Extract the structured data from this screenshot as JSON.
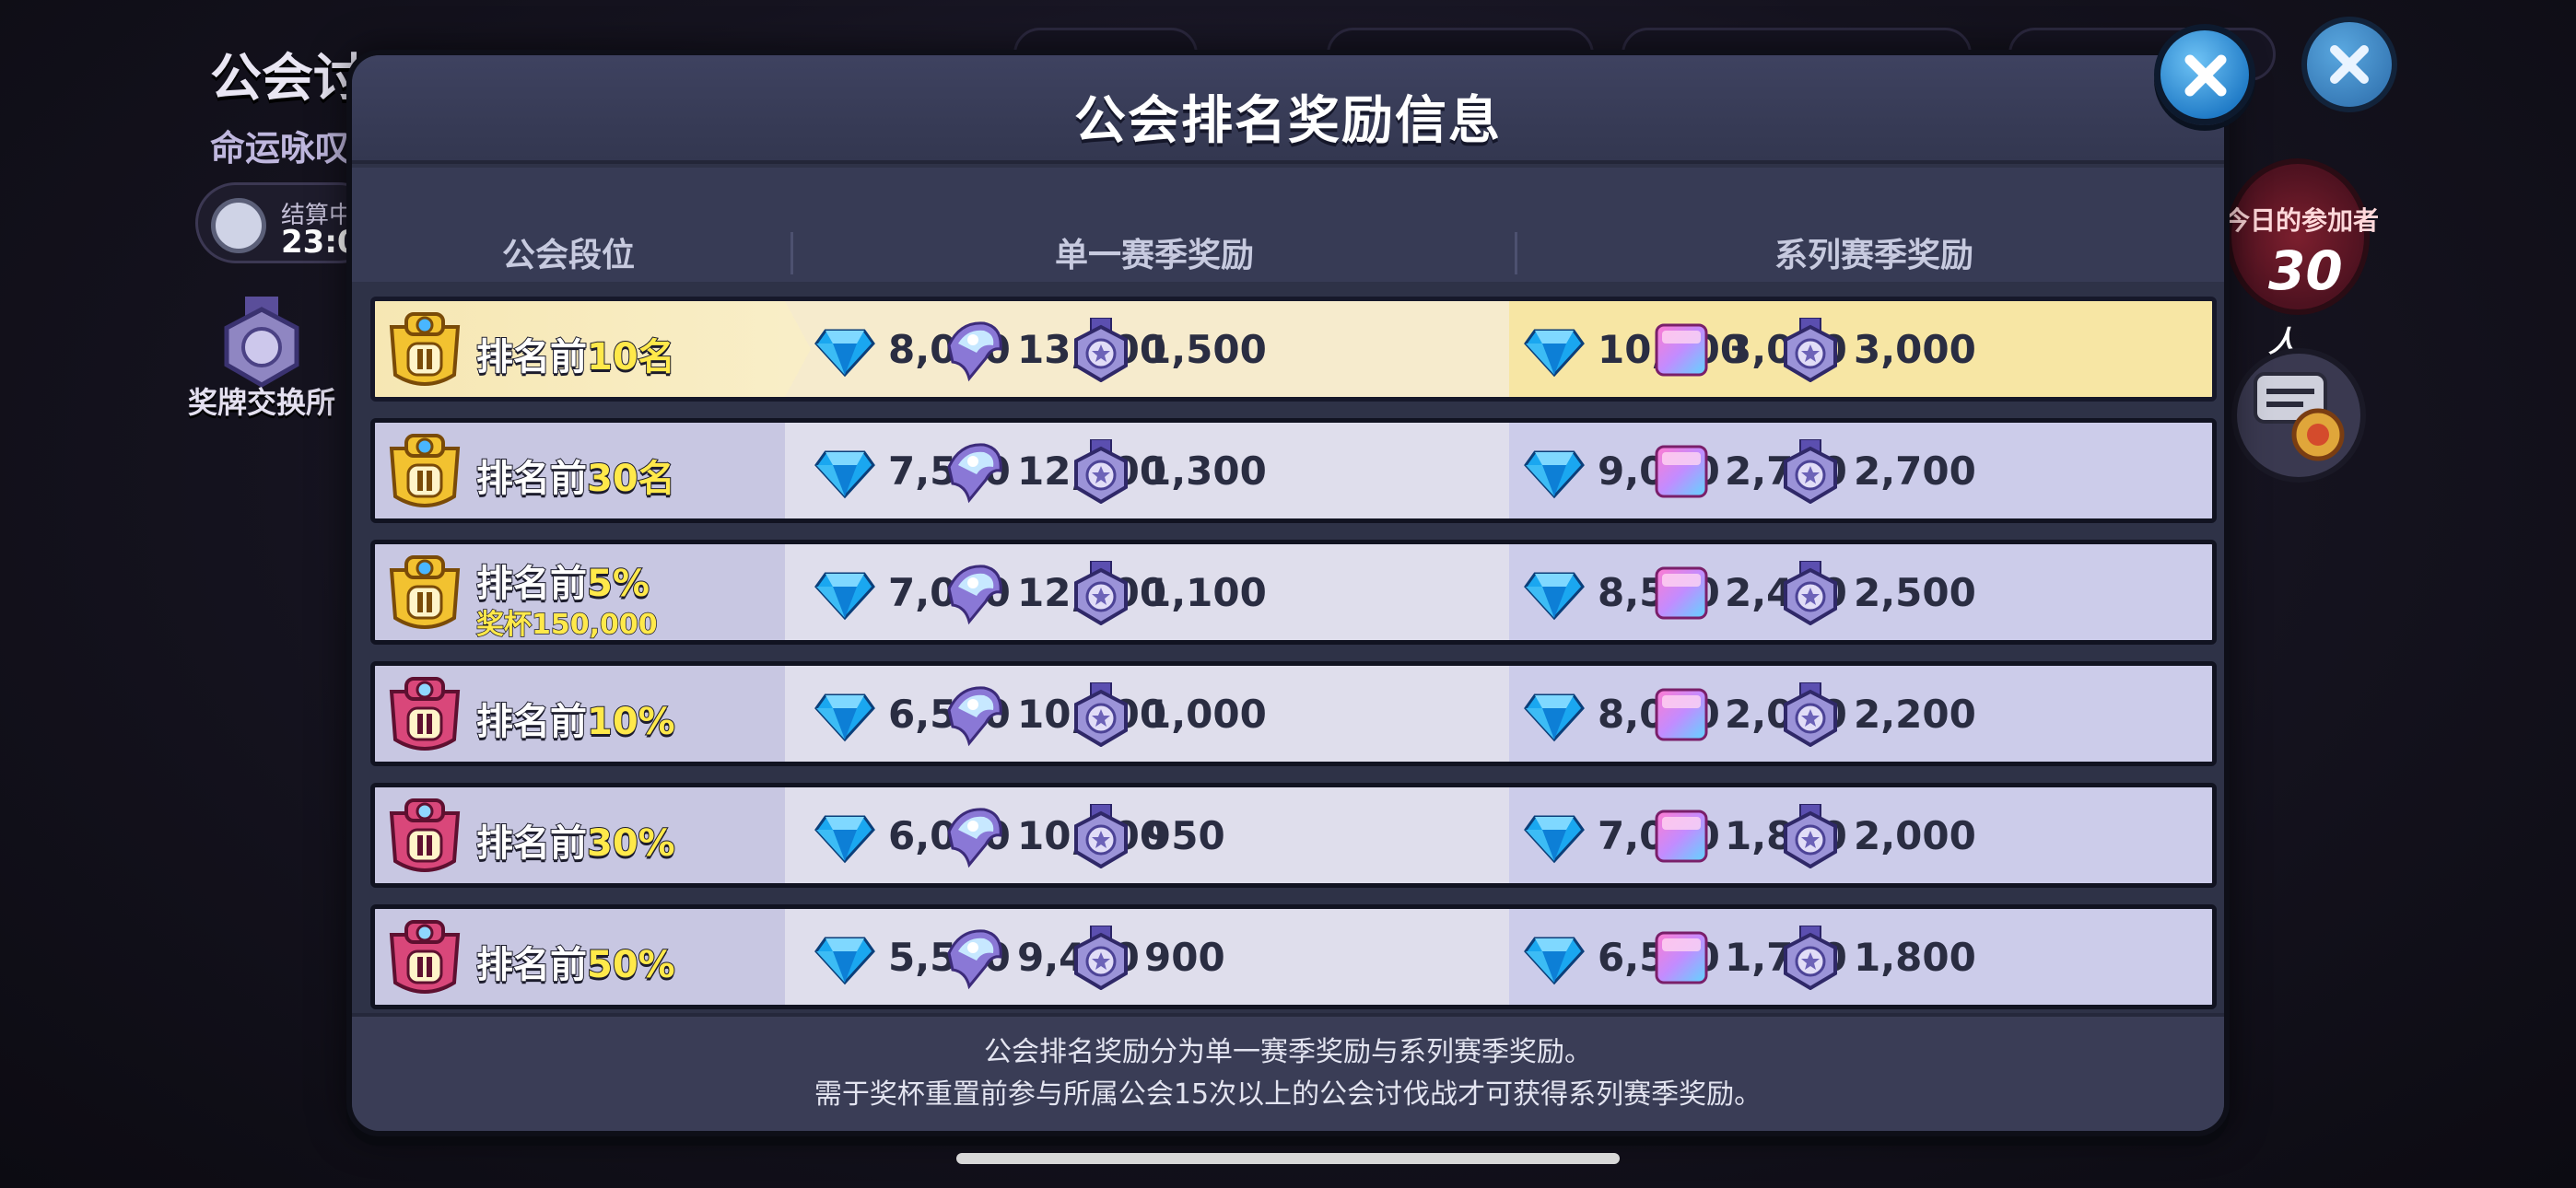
{
  "background": {
    "title": "公会讨伐战",
    "subtitle": "命运咏叹",
    "timer_label": "结算中",
    "timer_value": "23:0",
    "medal_exchange_label": "奖牌交换所",
    "participants_label": "今日的参加者",
    "participants_count": "30",
    "participants_unit": "人"
  },
  "modal": {
    "title": "公会排名奖励信息",
    "columns": {
      "rank": "公会段位",
      "single": "单一赛季奖励",
      "series": "系列赛季奖励"
    },
    "rows": [
      {
        "prefix": "排名前",
        "value": "10名",
        "sub": "",
        "tier": "gold",
        "single": [
          "8,000",
          "13,000",
          "1,500"
        ],
        "series": [
          "10,000",
          "3,000",
          "3,000"
        ]
      },
      {
        "prefix": "排名前",
        "value": "30名",
        "sub": "",
        "tier": "gold",
        "single": [
          "7,500",
          "12,500",
          "1,300"
        ],
        "series": [
          "9,000",
          "2,700",
          "2,700"
        ]
      },
      {
        "prefix": "排名前",
        "value": "5%",
        "sub": "奖杯150,000",
        "tier": "gold",
        "single": [
          "7,000",
          "12,000",
          "1,100"
        ],
        "series": [
          "8,500",
          "2,400",
          "2,500"
        ]
      },
      {
        "prefix": "排名前",
        "value": "10%",
        "sub": "",
        "tier": "pink",
        "single": [
          "6,500",
          "10,500",
          "1,000"
        ],
        "series": [
          "8,000",
          "2,000",
          "2,200"
        ]
      },
      {
        "prefix": "排名前",
        "value": "30%",
        "sub": "",
        "tier": "pink",
        "single": [
          "6,000",
          "10,000",
          "950"
        ],
        "series": [
          "7,000",
          "1,800",
          "2,000"
        ]
      },
      {
        "prefix": "排名前",
        "value": "50%",
        "sub": "",
        "tier": "pink",
        "single": [
          "5,500",
          "9,400",
          "900"
        ],
        "series": [
          "6,500",
          "1,700",
          "1,800"
        ]
      }
    ],
    "footer_line1": "公会排名奖励分为单一赛季奖励与系列赛季奖励。",
    "footer_line2": "需于奖杯重置前参与所属公会15次以上的公会讨伐战才可获得系列赛季奖励。"
  },
  "icons": {
    "single": [
      "gem-icon",
      "crystal-shard-icon",
      "medal-icon"
    ],
    "series": [
      "gem-icon",
      "rainbow-cube-icon",
      "medal-icon"
    ]
  },
  "colors": {
    "modal_bg": "#2e3247",
    "highlight_row": "#f7e6a4",
    "accent_text": "#ffe94a",
    "close_button": "#1f7ac6"
  }
}
